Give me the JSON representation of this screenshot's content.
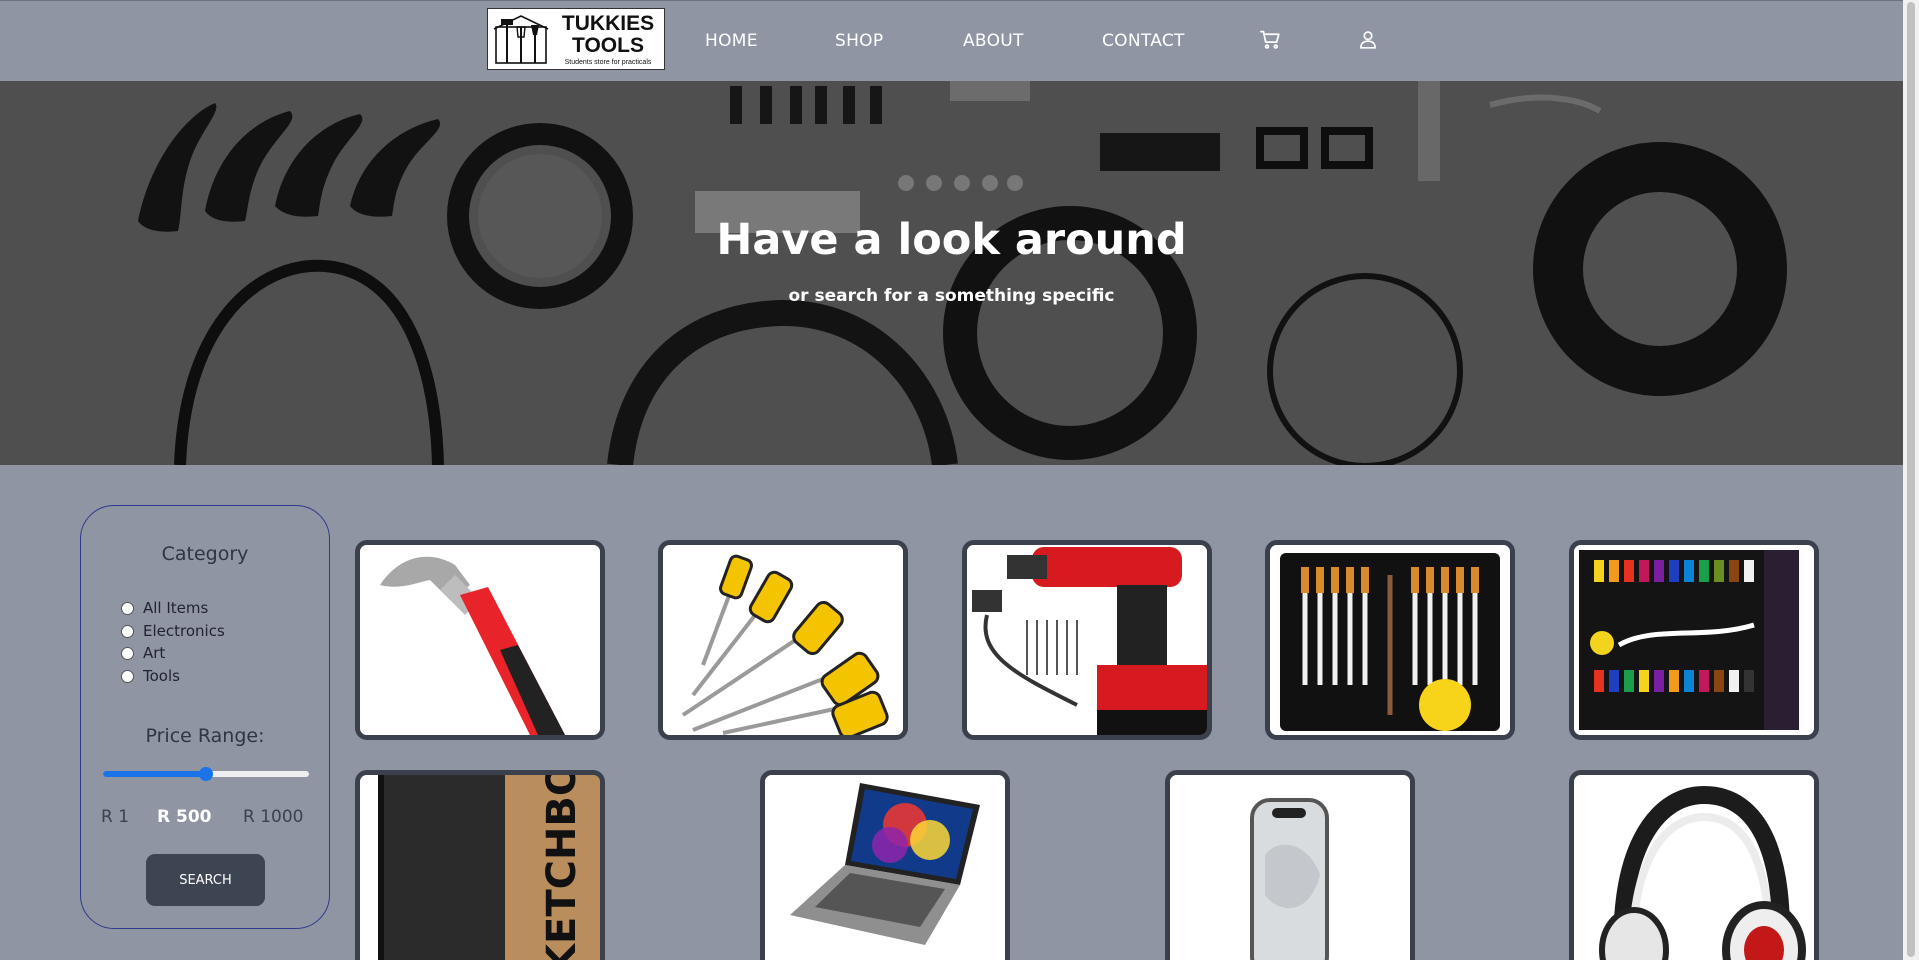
{
  "logo": {
    "title_line1": "TUKKIES",
    "title_line2": "TOOLS",
    "tagline": "Students store for practicals"
  },
  "nav": {
    "home": "HOME",
    "shop": "SHOP",
    "about": "ABOUT",
    "contact": "CONTACT",
    "cart_icon": "cart-icon",
    "account_icon": "user-icon"
  },
  "hero": {
    "title": "Have a look around",
    "subtitle": "or search for a something specific"
  },
  "filter": {
    "category_heading": "Category",
    "categories": [
      "All Items",
      "Electronics",
      "Art",
      "Tools"
    ],
    "price_heading": "Price Range:",
    "price_min": "R 1",
    "price_value": "R 500",
    "price_max": "R 1000",
    "slider_fraction": 0.5,
    "search_label": "SEARCH"
  },
  "products": [
    "hammer",
    "screwdriver-set",
    "cordless-drill-kit",
    "paint-brush-set",
    "acrylic-paint-set",
    "sketchbook",
    "laptop",
    "smartphone",
    "headphones"
  ],
  "colors": {
    "nav_bg": "#8f95a3",
    "page_bg": "#8f95a3",
    "accent": "#1a73e8",
    "button": "#3d4552",
    "card_border": "#3b414c"
  }
}
